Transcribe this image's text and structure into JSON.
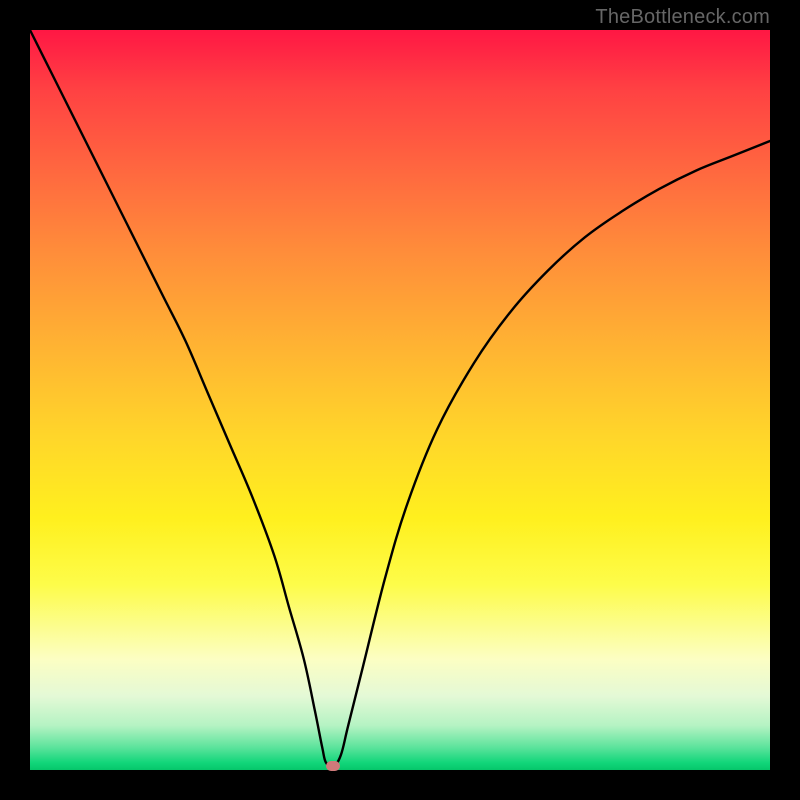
{
  "watermark": "TheBottleneck.com",
  "chart_data": {
    "type": "line",
    "title": "",
    "xlabel": "",
    "ylabel": "",
    "xlim": [
      0,
      100
    ],
    "ylim": [
      0,
      100
    ],
    "grid": false,
    "legend": false,
    "gradient_stops": [
      {
        "pos": 0,
        "color": "#ff1744"
      },
      {
        "pos": 8,
        "color": "#ff4143"
      },
      {
        "pos": 20,
        "color": "#ff6b3f"
      },
      {
        "pos": 30,
        "color": "#ff8d3a"
      },
      {
        "pos": 42,
        "color": "#ffb133"
      },
      {
        "pos": 55,
        "color": "#ffd62a"
      },
      {
        "pos": 66,
        "color": "#fff01e"
      },
      {
        "pos": 75,
        "color": "#fdfc4a"
      },
      {
        "pos": 85,
        "color": "#fcfec3"
      },
      {
        "pos": 90,
        "color": "#e4f9d6"
      },
      {
        "pos": 94,
        "color": "#b5f3c3"
      },
      {
        "pos": 97,
        "color": "#5ae39b"
      },
      {
        "pos": 99,
        "color": "#12d67a"
      },
      {
        "pos": 100,
        "color": "#06c66a"
      }
    ],
    "series": [
      {
        "name": "bottleneck-curve",
        "x": [
          0,
          3,
          6,
          9,
          12,
          15,
          18,
          21,
          24,
          27,
          30,
          33,
          35,
          37,
          38.5,
          39.5,
          40,
          41,
          42,
          43,
          45,
          48,
          51,
          55,
          60,
          65,
          70,
          75,
          80,
          85,
          90,
          95,
          100
        ],
        "y": [
          100,
          94,
          88,
          82,
          76,
          70,
          64,
          58,
          51,
          44,
          37,
          29,
          22,
          15,
          8,
          3,
          1,
          0.5,
          2,
          6,
          14,
          26,
          36,
          46,
          55,
          62,
          67.5,
          72,
          75.5,
          78.5,
          81,
          83,
          85
        ]
      }
    ],
    "marker": {
      "x": 41,
      "y": 0.5,
      "color": "#cf7a7a"
    }
  }
}
